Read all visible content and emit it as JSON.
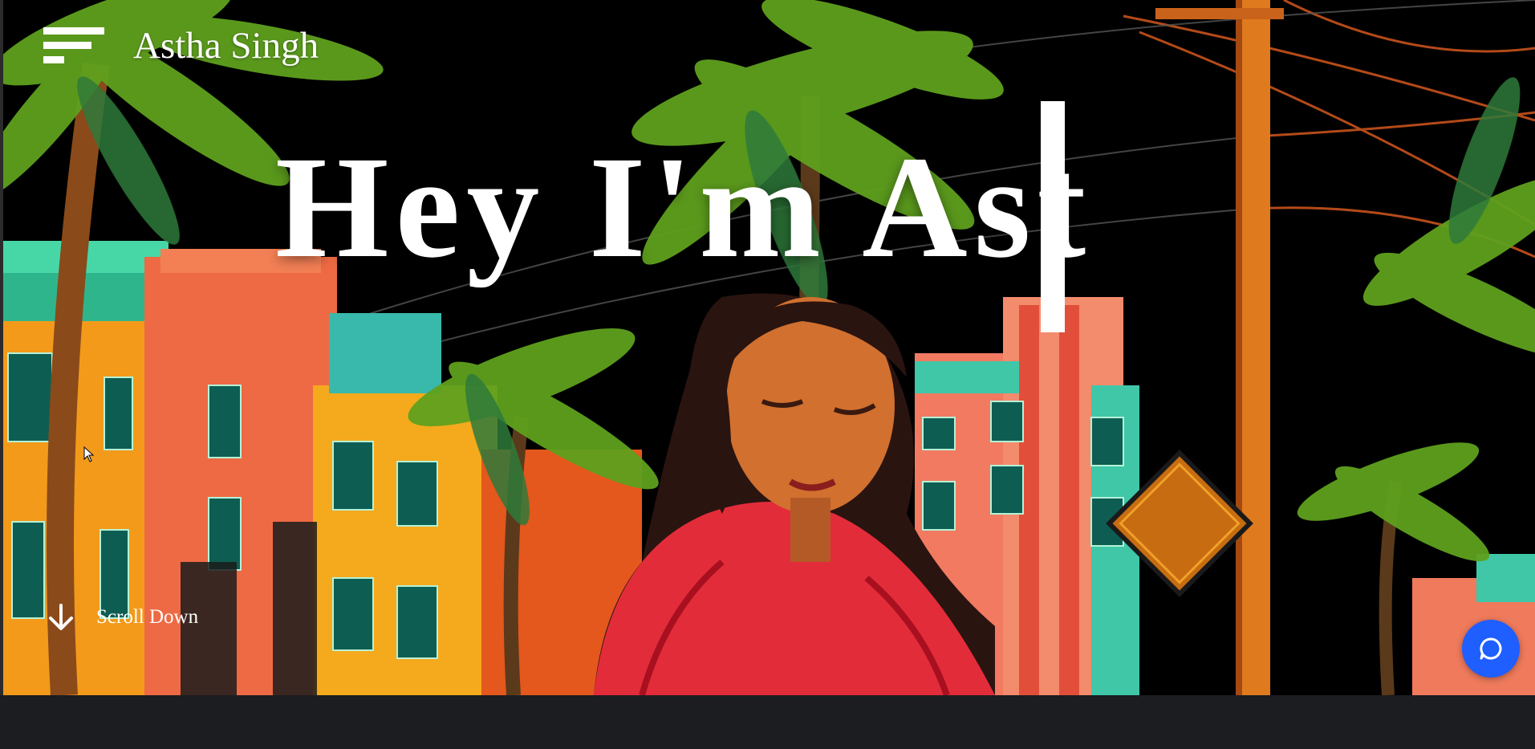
{
  "header": {
    "brand": "Astha Singh",
    "menu_icon": "hamburger-menu-icon"
  },
  "hero": {
    "headline": "Hey I'm Ast",
    "scroll_label": "Scroll Down",
    "scroll_icon": "arrow-down-icon"
  },
  "chat": {
    "icon": "chat-bubble-icon",
    "color": "#1f5eff"
  },
  "colors": {
    "background": "#000000",
    "footer": "#1b1d20"
  }
}
